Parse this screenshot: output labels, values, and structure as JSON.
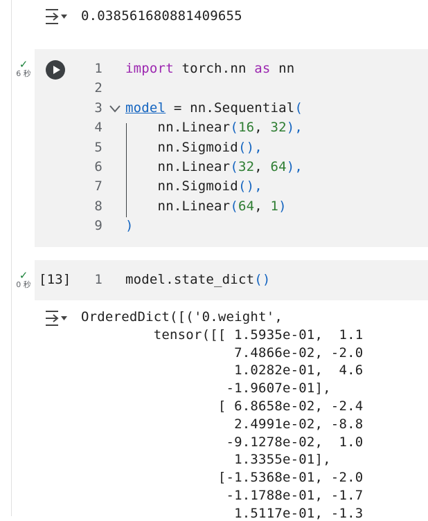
{
  "output1": {
    "text": "0.038561680881409655"
  },
  "cell1": {
    "status_time": "6 秒",
    "lines": [
      {
        "no": "1",
        "parts": [
          {
            "t": "import",
            "c": "kw"
          },
          {
            "t": " torch.nn ",
            "c": ""
          },
          {
            "t": "as",
            "c": "kw"
          },
          {
            "t": " nn",
            "c": ""
          }
        ]
      },
      {
        "no": "2",
        "parts": []
      },
      {
        "no": "3",
        "parts": [
          {
            "t": "model",
            "c": "ident"
          },
          {
            "t": " = nn.Sequential",
            "c": ""
          },
          {
            "t": "(",
            "c": "paren"
          }
        ]
      },
      {
        "no": "4",
        "parts": [
          {
            "t": "    nn.Linear",
            "c": ""
          },
          {
            "t": "(",
            "c": "paren"
          },
          {
            "t": "16",
            "c": "num"
          },
          {
            "t": ", ",
            "c": ""
          },
          {
            "t": "32",
            "c": "num"
          },
          {
            "t": "),",
            "c": "paren"
          }
        ]
      },
      {
        "no": "5",
        "parts": [
          {
            "t": "    nn.Sigmoid",
            "c": ""
          },
          {
            "t": "(),",
            "c": "paren"
          }
        ]
      },
      {
        "no": "6",
        "parts": [
          {
            "t": "    nn.Linear",
            "c": ""
          },
          {
            "t": "(",
            "c": "paren"
          },
          {
            "t": "32",
            "c": "num"
          },
          {
            "t": ", ",
            "c": ""
          },
          {
            "t": "64",
            "c": "num"
          },
          {
            "t": "),",
            "c": "paren"
          }
        ]
      },
      {
        "no": "7",
        "parts": [
          {
            "t": "    nn.Sigmoid",
            "c": ""
          },
          {
            "t": "(),",
            "c": "paren"
          }
        ]
      },
      {
        "no": "8",
        "parts": [
          {
            "t": "    nn.Linear",
            "c": ""
          },
          {
            "t": "(",
            "c": "paren"
          },
          {
            "t": "64",
            "c": "num"
          },
          {
            "t": ", ",
            "c": ""
          },
          {
            "t": "1",
            "c": "num"
          },
          {
            "t": ")",
            "c": "paren"
          }
        ]
      },
      {
        "no": "9",
        "parts": [
          {
            "t": ")",
            "c": "paren"
          }
        ]
      }
    ]
  },
  "cell2": {
    "status_time": "0 秒",
    "exec_count": "[13]",
    "line_no": "1",
    "code_prefix": "model.state_dict",
    "code_parens": "()"
  },
  "output2": {
    "lines": [
      "OrderedDict([('0.weight',",
      "         tensor([[ 1.5935e-01,  1.1",
      "                   7.4866e-02, -2.0",
      "                   1.0282e-01,  4.6",
      "                  -1.9607e-01],",
      "                 [ 6.8658e-02, -2.4",
      "                   2.4991e-02, -8.8",
      "                  -9.1278e-02,  1.0",
      "                   1.3355e-01],",
      "                 [-1.5368e-01, -2.0",
      "                  -1.1788e-01, -1.7",
      "                   1.5117e-01, -1.3"
    ]
  }
}
